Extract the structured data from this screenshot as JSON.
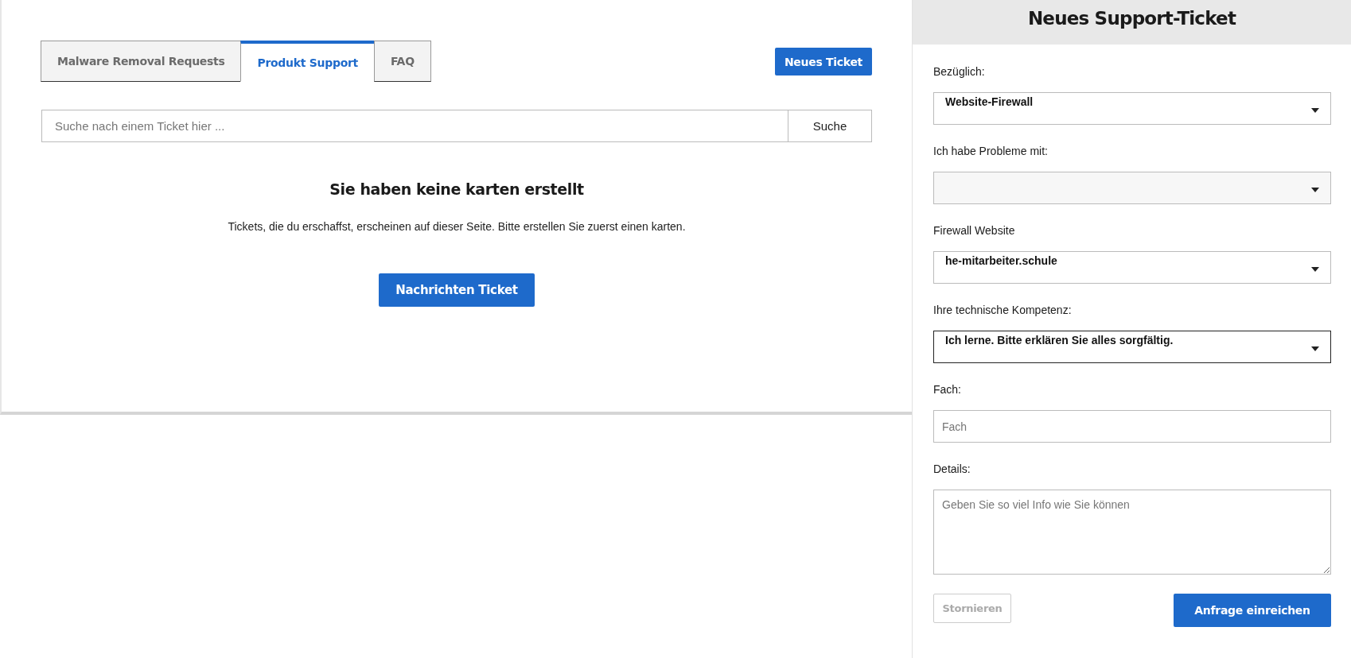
{
  "tabs": [
    {
      "label": "Malware Removal Requests",
      "selected": false
    },
    {
      "label": "Produkt Support",
      "selected": true
    },
    {
      "label": "FAQ",
      "selected": false
    }
  ],
  "new_ticket_button": "Neues Ticket",
  "search": {
    "placeholder": "Suche nach einem Ticket hier ...",
    "button": "Suche"
  },
  "empty_state": {
    "title": "Sie haben keine karten erstellt",
    "text": "Tickets, die du erschaffst, erscheinen auf dieser Seite. Bitte erstellen Sie zuerst einen karten.",
    "button": "Nachrichten Ticket"
  },
  "form": {
    "title": "Neues Support-Ticket",
    "fields": [
      {
        "kind": "select",
        "label": "Bezüglich:",
        "value": "Website-Firewall",
        "focused": false
      },
      {
        "kind": "select",
        "label": "Ich habe Probleme mit:",
        "focused": false
      },
      {
        "kind": "select",
        "label": "Firewall Website",
        "value": "he-mitarbeiter.schule",
        "focused": false
      },
      {
        "kind": "select",
        "label": "Ihre technische Kompetenz:",
        "value": "Ich lerne. Bitte erklären Sie alles sorgfältig.",
        "focused": true
      },
      {
        "kind": "input",
        "label": "Fach:",
        "placeholder": "Fach"
      },
      {
        "kind": "textarea",
        "label": "Details:",
        "placeholder": "Geben Sie so viel Info wie Sie können"
      }
    ],
    "cancel": {
      "label": "Stornieren",
      "disabled": true
    },
    "submit": {
      "label": "Anfrage einreichen",
      "disabled": false
    }
  }
}
